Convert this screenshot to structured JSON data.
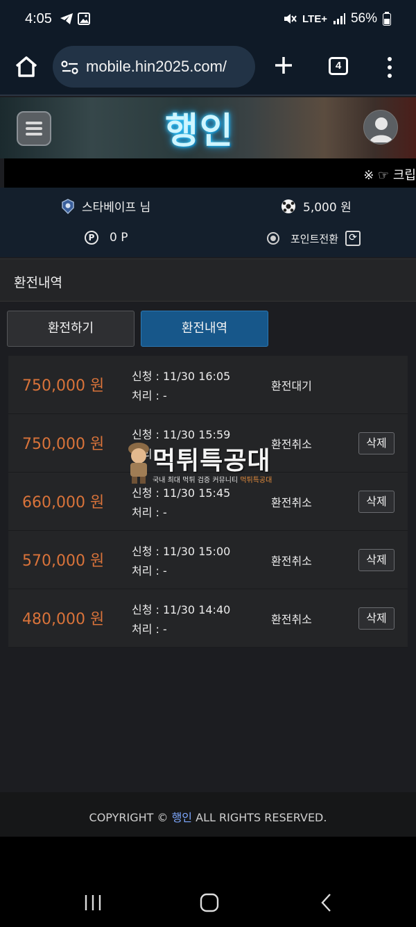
{
  "status_bar": {
    "time": "4:05",
    "network": "LTE+",
    "battery": "56%"
  },
  "browser": {
    "url": "mobile.hin2025.com/",
    "tab_count": "4"
  },
  "site": {
    "logo": "행인",
    "marquee": "※ ☞ 크립"
  },
  "user": {
    "name": "스타베이프 님",
    "balance": "5,000 원",
    "points_icon": "P",
    "points": "0 P",
    "convert_label": "포인트전환"
  },
  "page": {
    "section_title": "환전내역",
    "tab_apply": "환전하기",
    "tab_history": "환전내역"
  },
  "records": [
    {
      "amount": "750,000 원",
      "request": "신청 : 11/30 16:05",
      "process": "처리 : -",
      "status": "환전대기",
      "delete": ""
    },
    {
      "amount": "750,000 원",
      "request": "신청 : 11/30 15:59",
      "process": "처리 : -",
      "status": "환전취소",
      "delete": "삭제"
    },
    {
      "amount": "660,000 원",
      "request": "신청 : 11/30 15:45",
      "process": "처리 : -",
      "status": "환전취소",
      "delete": "삭제"
    },
    {
      "amount": "570,000 원",
      "request": "신청 : 11/30 15:00",
      "process": "처리 : -",
      "status": "환전취소",
      "delete": "삭제"
    },
    {
      "amount": "480,000 원",
      "request": "신청 : 11/30 14:40",
      "process": "처리 : -",
      "status": "환전취소",
      "delete": "삭제"
    }
  ],
  "watermark": {
    "title": "먹튀특공대",
    "subtitle": "국내 최대 먹튀 검증 커뮤니티",
    "subtitle_brand": "먹튀특공대"
  },
  "footer": {
    "prefix": "COPYRIGHT © ",
    "brand": "행인",
    "suffix": " ALL RIGHTS RESERVED."
  },
  "colors": {
    "amount": "#d9733a",
    "active_tab": "#17578a",
    "header_bg": "#0f1a27"
  }
}
